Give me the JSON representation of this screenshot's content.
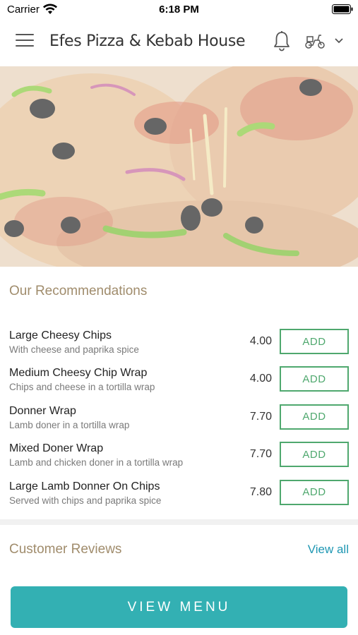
{
  "status_bar": {
    "carrier": "Carrier",
    "time": "6:18 PM"
  },
  "header": {
    "title": "Efes Pizza & Kebab House",
    "icons": [
      "menu-icon",
      "bell-icon",
      "scooter-icon",
      "chevron-down-icon"
    ]
  },
  "hero": {
    "image": "pizza-photo"
  },
  "recommendations": {
    "title": "Our Recommendations",
    "add_label": "ADD",
    "items": [
      {
        "name": "Large Cheesy Chips",
        "description": "With cheese and paprika spice",
        "price": "4.00"
      },
      {
        "name": "Medium Cheesy Chip Wrap",
        "description": "Chips and cheese in a tortilla wrap",
        "price": "4.00"
      },
      {
        "name": "Donner Wrap",
        "description": "Lamb doner in a tortilla wrap",
        "price": "7.70"
      },
      {
        "name": "Mixed Doner Wrap",
        "description": "Lamb and chicken doner in a tortilla wrap",
        "price": "7.70"
      },
      {
        "name": "Large Lamb Donner On Chips",
        "description": "Served with chips and paprika spice",
        "price": "7.80"
      }
    ]
  },
  "reviews": {
    "title": "Customer Reviews",
    "view_all": "View all"
  },
  "footer": {
    "view_menu": "VIEW MENU"
  },
  "colors": {
    "accent_green": "#4fa86e",
    "teal_button": "#33b0b3",
    "link_blue": "#1f97b3",
    "section_title": "#a08c6c"
  }
}
